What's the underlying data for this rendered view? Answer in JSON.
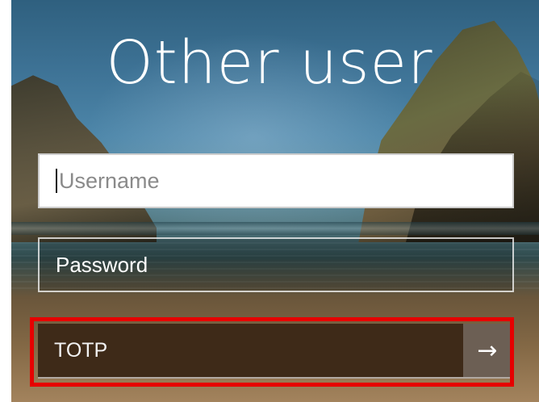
{
  "login": {
    "title": "Other user",
    "username": {
      "placeholder": "Username",
      "value": ""
    },
    "password": {
      "placeholder": "Password"
    },
    "totp": {
      "placeholder": "TOTP",
      "submit_icon": "→"
    }
  },
  "colors": {
    "highlight_border": "#e60000",
    "totp_background": "#3e2a18",
    "submit_background": "#6c5f54"
  },
  "icons": {
    "submit": "arrow-right-icon"
  }
}
